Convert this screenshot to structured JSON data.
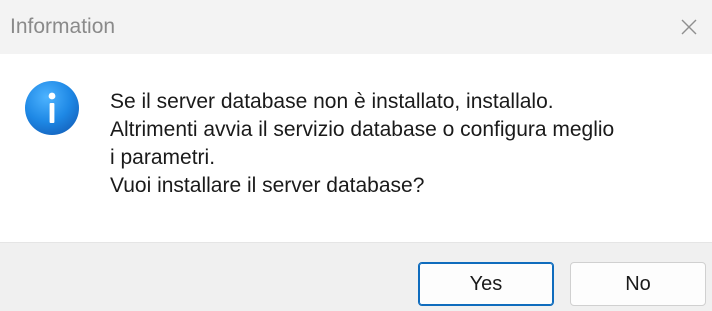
{
  "window": {
    "title": "Information",
    "close_icon": "close-icon"
  },
  "dialog": {
    "icon": "info-icon",
    "accent_color": "#1e88e5",
    "message_lines": [
      "Se il server database non è installato, installalo.",
      "Altrimenti avvia il servizio database o configura meglio",
      "i parametri.",
      "Vuoi installare il server database?"
    ]
  },
  "buttons": {
    "yes_label": "Yes",
    "no_label": "No",
    "default_border_color": "#0f6cbd"
  }
}
